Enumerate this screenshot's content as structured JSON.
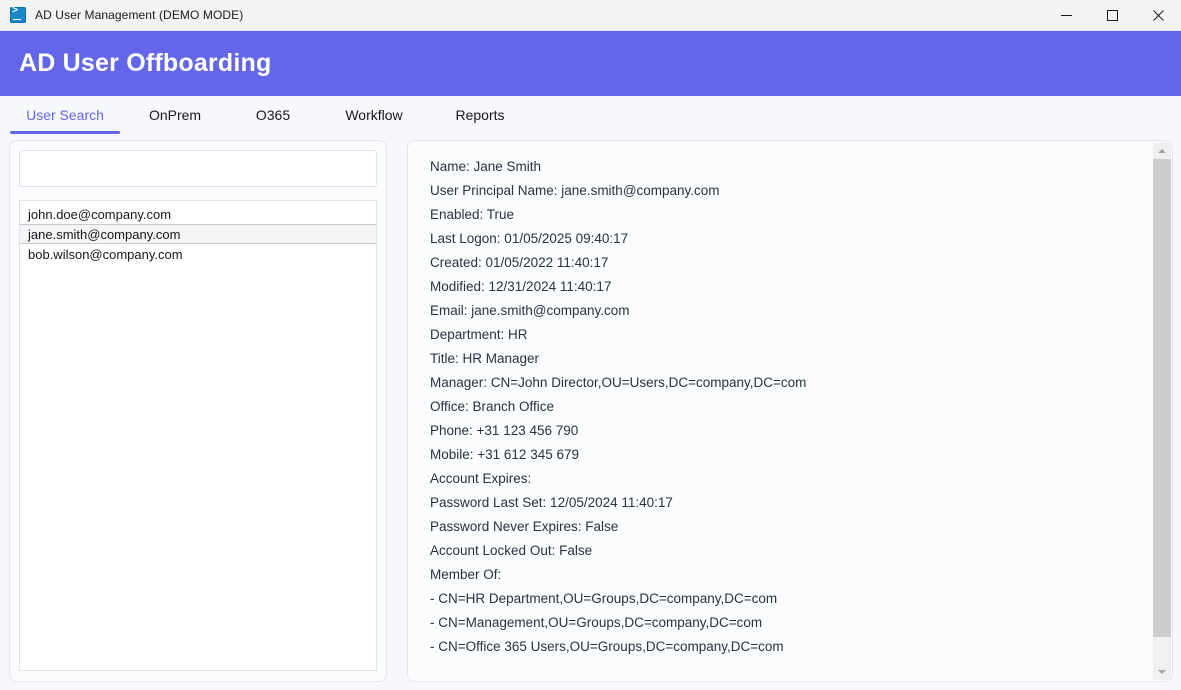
{
  "window": {
    "title": "AD User Management (DEMO MODE)",
    "icon": "powershell-icon",
    "minimize_label": "Minimize",
    "maximize_label": "Maximize",
    "close_label": "Close"
  },
  "header": {
    "title": "AD User Offboarding",
    "accent_color": "#6366e8"
  },
  "tabs": [
    {
      "label": "User Search",
      "active": true
    },
    {
      "label": "OnPrem",
      "active": false
    },
    {
      "label": "O365",
      "active": false
    },
    {
      "label": "Workflow",
      "active": false
    },
    {
      "label": "Reports",
      "active": false
    }
  ],
  "search": {
    "value": "",
    "placeholder": ""
  },
  "user_list": {
    "items": [
      {
        "label": "john.doe@company.com",
        "selected": false
      },
      {
        "label": "jane.smith@company.com",
        "selected": true
      },
      {
        "label": "bob.wilson@company.com",
        "selected": false
      }
    ]
  },
  "details": {
    "lines": [
      "Name: Jane Smith",
      "User Principal Name: jane.smith@company.com",
      "Enabled: True",
      "Last Logon: 01/05/2025 09:40:17",
      "Created: 01/05/2022 11:40:17",
      "Modified: 12/31/2024 11:40:17",
      "Email: jane.smith@company.com",
      "Department: HR",
      "Title: HR Manager",
      "Manager: CN=John Director,OU=Users,DC=company,DC=com",
      "Office: Branch Office",
      "Phone: +31 123 456 790",
      "Mobile: +31 612 345 679",
      "Account Expires:",
      "Password Last Set: 12/05/2024 11:40:17",
      "Password Never Expires: False",
      "Account Locked Out: False",
      "Member Of:",
      "- CN=HR Department,OU=Groups,DC=company,DC=com",
      "- CN=Management,OU=Groups,DC=company,DC=com",
      "- CN=Office 365 Users,OU=Groups,DC=company,DC=com"
    ]
  },
  "scrollbar": {
    "up_label": "Scroll up",
    "down_label": "Scroll down"
  }
}
